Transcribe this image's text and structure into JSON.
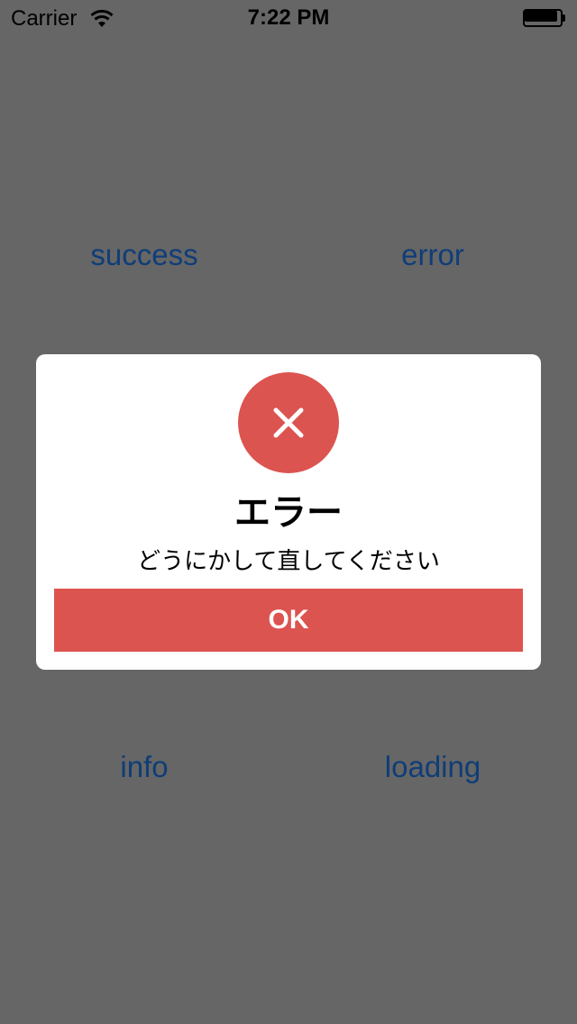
{
  "status_bar": {
    "carrier": "Carrier",
    "time": "7:22 PM",
    "wifi_icon": "wifi-icon",
    "battery_icon": "battery-icon"
  },
  "buttons": {
    "success": "success",
    "error": "error",
    "info": "info",
    "loading": "loading"
  },
  "dialog": {
    "icon": "close-icon",
    "title": "エラー",
    "message": "どうにかして直してください",
    "ok_label": "OK"
  },
  "colors": {
    "background_overlay": "#666666",
    "accent_red": "#dc5450",
    "button_text": "#0f3d78",
    "dialog_background": "#ffffff"
  }
}
